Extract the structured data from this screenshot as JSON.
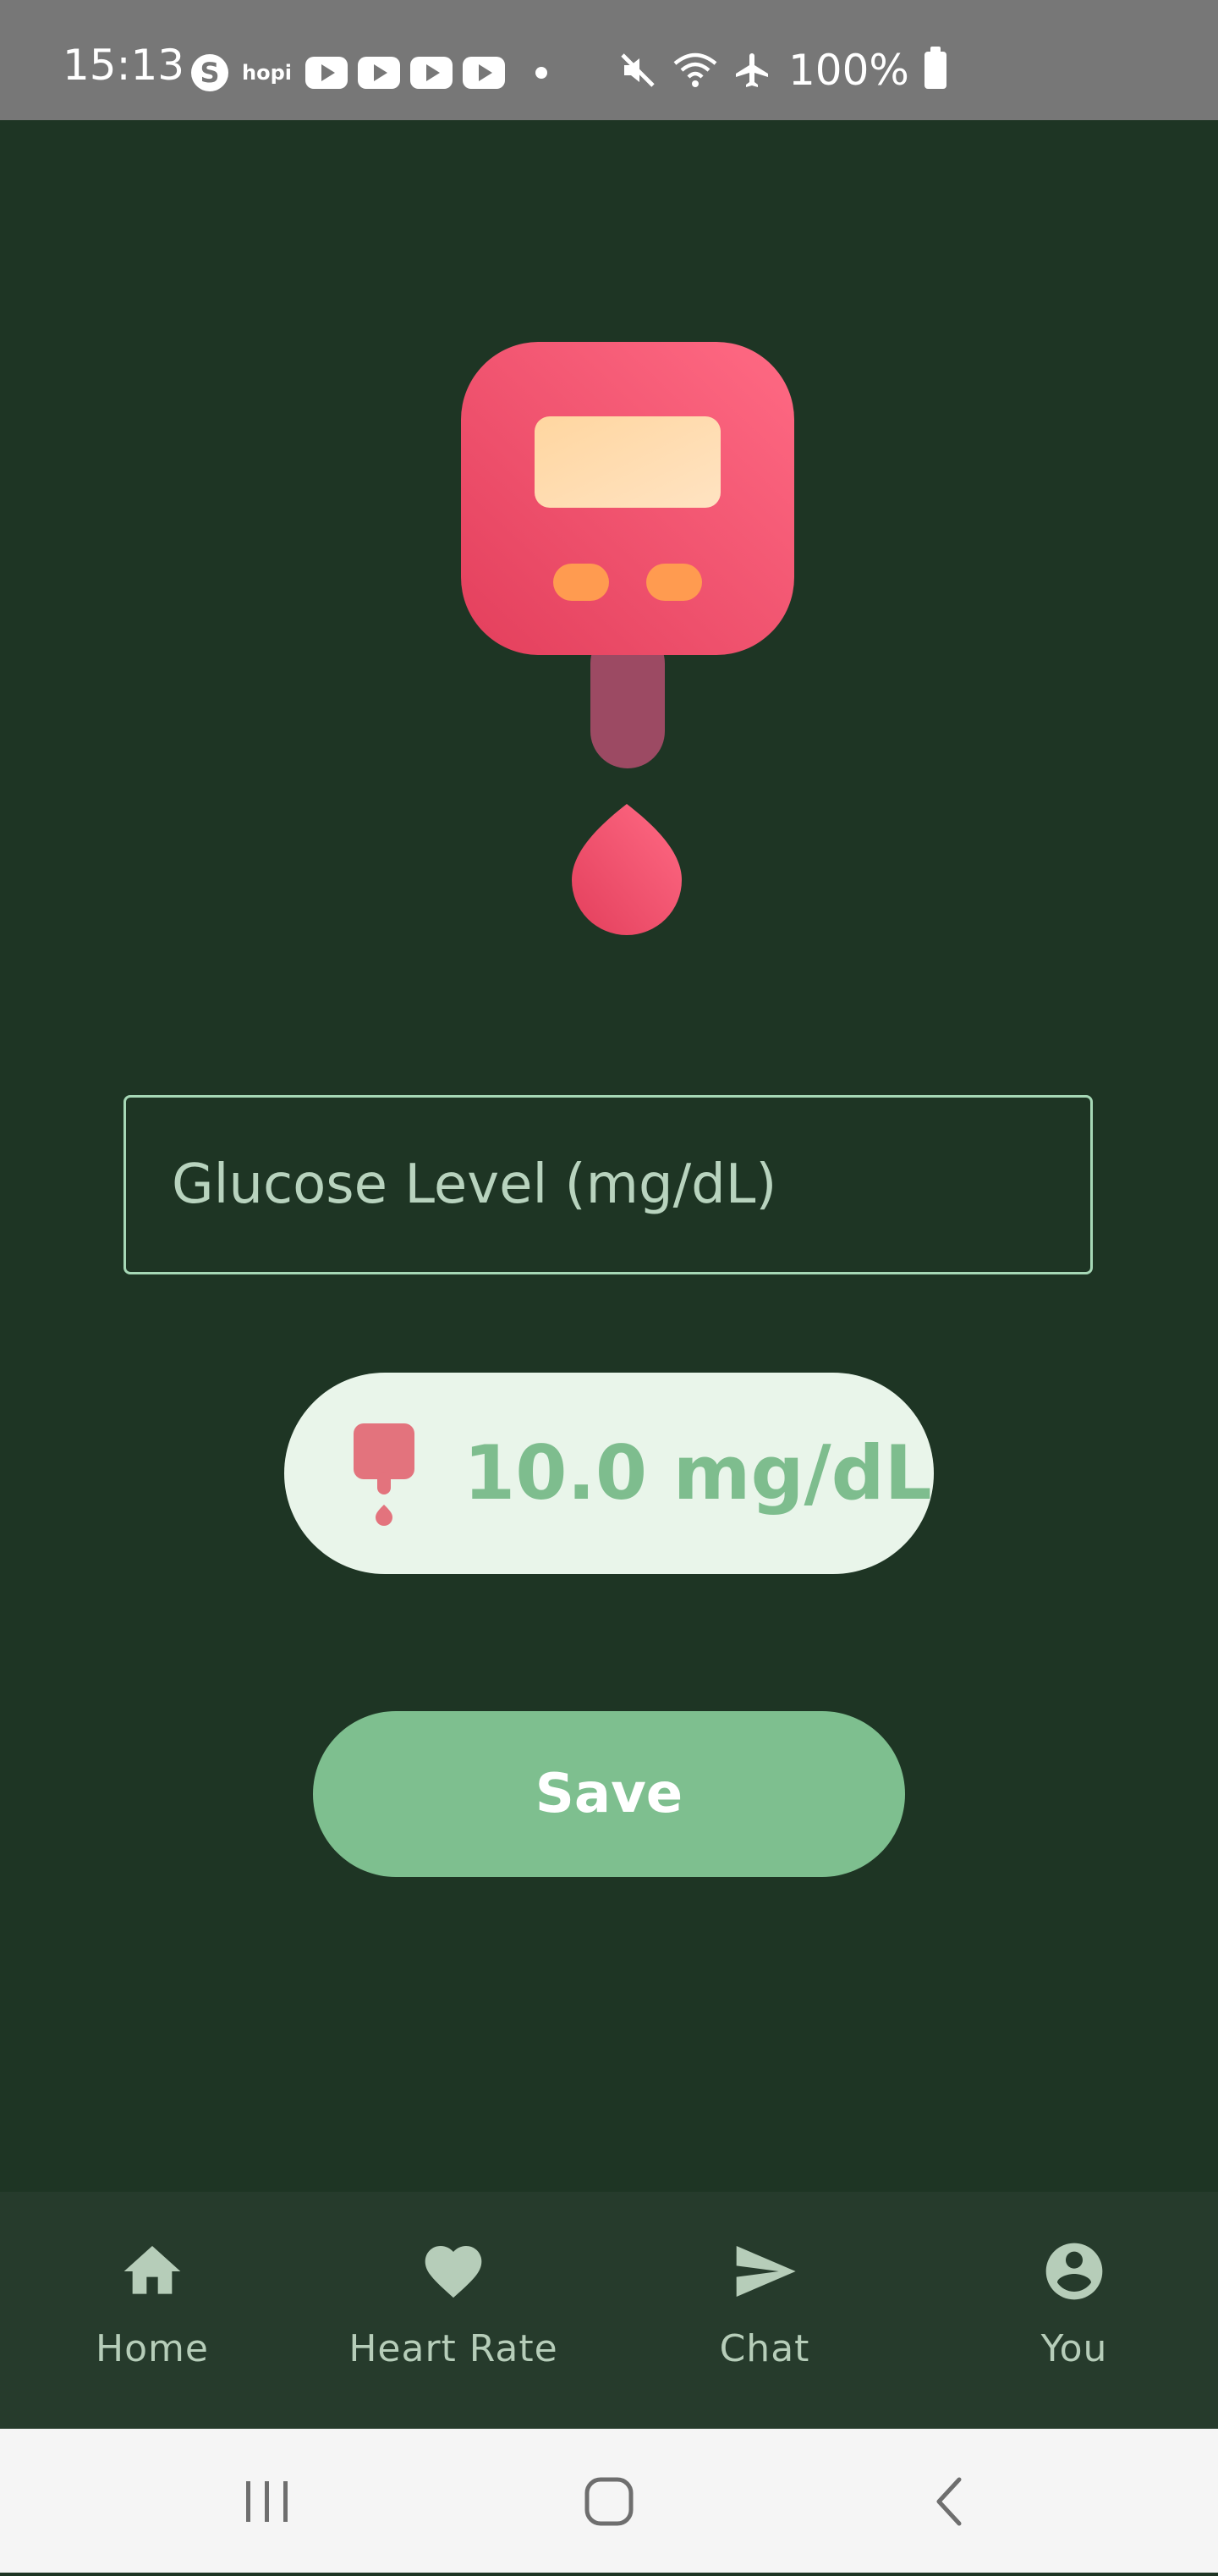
{
  "status_bar": {
    "time": "15:13",
    "notification_icons": [
      "skype-icon",
      "hopi-icon",
      "youtube-icon",
      "youtube-icon",
      "youtube-icon",
      "youtube-icon"
    ],
    "hopi_label": "hopi",
    "right_icons": [
      "mute-icon",
      "wifi-icon",
      "airplane-icon"
    ],
    "battery": "100%"
  },
  "illustration": {
    "icon": "glucose-meter-icon",
    "drop_icon": "blood-drop-icon"
  },
  "form": {
    "glucose_placeholder": "Glucose Level (mg/dL)",
    "glucose_value": ""
  },
  "reading": {
    "icon": "glucose-meter-small-icon",
    "text": "10.0 mg/dL"
  },
  "actions": {
    "save_label": "Save"
  },
  "bottom_nav": {
    "items": [
      {
        "label": "Home",
        "icon": "home-icon"
      },
      {
        "label": "Heart Rate",
        "icon": "heart-icon"
      },
      {
        "label": "Chat",
        "icon": "send-icon"
      },
      {
        "label": "You",
        "icon": "account-icon"
      }
    ]
  },
  "system_nav": [
    "recents-icon",
    "home-circle-icon",
    "back-icon"
  ],
  "colors": {
    "background": "#1e3524",
    "accent_green": "#7ebf8f",
    "meter_red": "#ec4f6b",
    "nav_background": "#263b2c"
  }
}
